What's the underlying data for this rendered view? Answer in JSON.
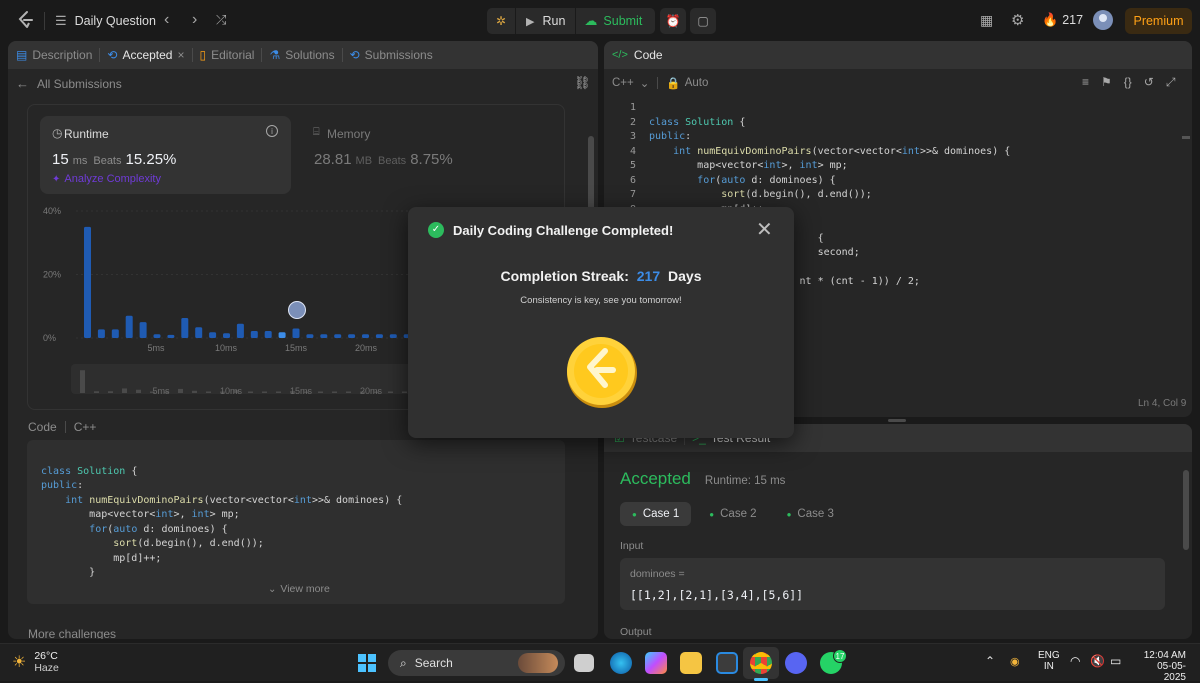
{
  "topbar": {
    "title": "Daily Question",
    "run_label": "Run",
    "submit_label": "Submit",
    "streak_count": "217",
    "premium_label": "Premium"
  },
  "left_panel": {
    "tabs": [
      "Description",
      "Accepted",
      "Editorial",
      "Solutions",
      "Submissions"
    ],
    "back_label": "All Submissions",
    "runtime": {
      "label": "Runtime",
      "value": "15",
      "unit": "ms",
      "beats_label": "Beats",
      "beats_value": "15.25%",
      "analyze_label": "Analyze Complexity"
    },
    "memory": {
      "label": "Memory",
      "value": "28.81",
      "unit": "MB",
      "beats_label": "Beats",
      "beats_value": "8.75%"
    },
    "code_header": {
      "label": "Code",
      "lang": "C++"
    },
    "view_more": "View more",
    "more_challenges": "More challenges"
  },
  "chart_data": {
    "type": "bar",
    "ytick_labels": [
      "40%",
      "20%",
      "0%"
    ],
    "xtick_labels": [
      "5ms",
      "10ms",
      "15ms",
      "20ms"
    ],
    "minimap_labels": [
      "5ms",
      "10ms",
      "15ms",
      "20ms"
    ],
    "ylim": [
      0,
      40
    ],
    "x": [
      1,
      2,
      3,
      4,
      5,
      6,
      7,
      8,
      9,
      10,
      11,
      12,
      13,
      14,
      15,
      16,
      17,
      18,
      19,
      20,
      21,
      22,
      23,
      24
    ],
    "values": [
      35,
      2.7,
      2.7,
      7,
      5,
      1.2,
      1,
      6.3,
      3.4,
      1.8,
      1.5,
      4.5,
      2.2,
      2.2,
      1.8,
      3,
      1.2,
      1.2,
      1.2,
      1.2,
      1.2,
      1.2,
      1.2,
      1.2
    ],
    "highlight_x": 15
  },
  "editor": {
    "title": "Code",
    "lang": "C++",
    "mode": "Auto",
    "status": "Ln 4, Col 9"
  },
  "bottom_panel": {
    "tabs": [
      "Testcase",
      "Test Result"
    ],
    "status": "Accepted",
    "runtime": "Runtime: 15 ms",
    "cases": [
      "Case 1",
      "Case 2",
      "Case 3"
    ],
    "input_label": "Input",
    "param_name": "dominoes =",
    "param_value": "[[1,2],[2,1],[3,4],[5,6]]",
    "output_label": "Output"
  },
  "modal": {
    "title": "Daily Coding Challenge Completed!",
    "streak_label": "Completion Streak:",
    "streak_value": "217",
    "streak_unit": "Days",
    "subtitle": "Consistency is key, see you tomorrow!"
  },
  "taskbar": {
    "temp": "26°C",
    "weather": "Haze",
    "search": "Search",
    "whatsapp_badge": "17",
    "lang1": "ENG",
    "lang2": "IN",
    "time": "12:04 AM",
    "date": "05-05-2025"
  },
  "colors": {
    "accent_green": "#2cbb5d",
    "accent_blue": "#3c8ce7",
    "bar_blue": "#1f5bb3",
    "premium": "#ffa116"
  }
}
